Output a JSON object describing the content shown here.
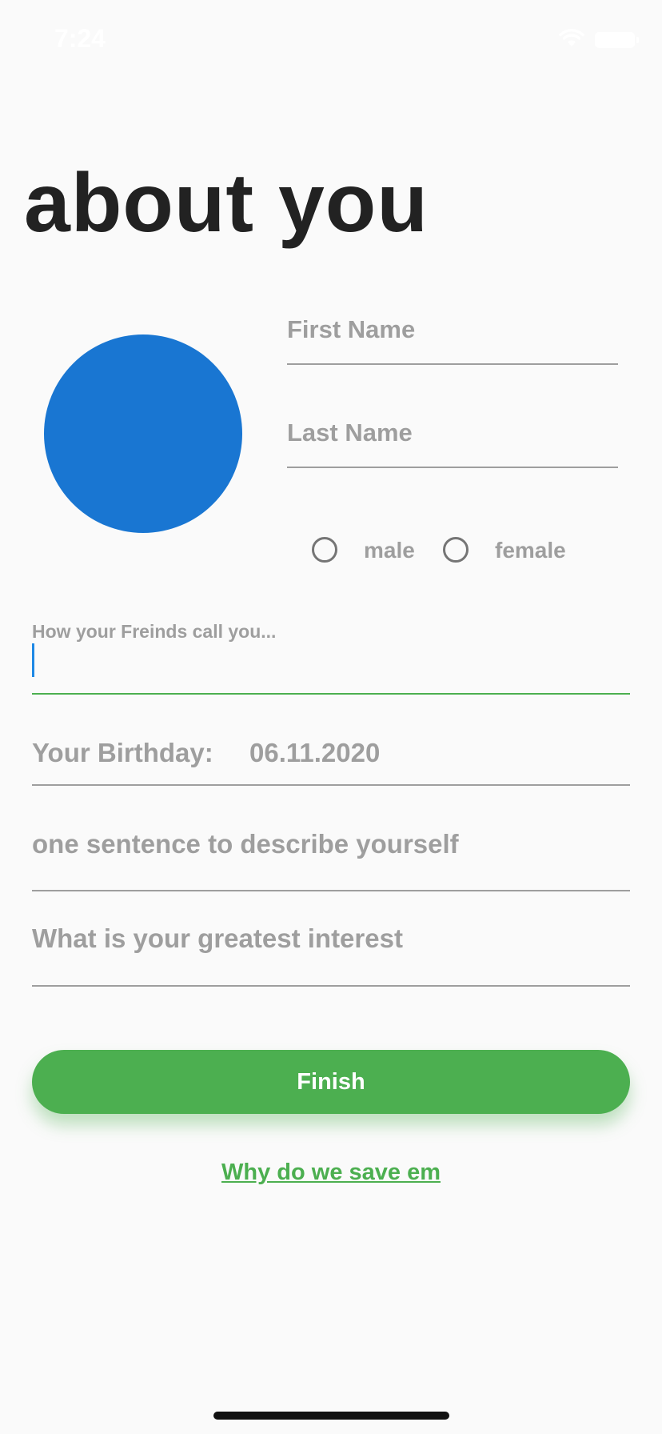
{
  "status_bar": {
    "time": "7:24",
    "wifi_icon": "wifi-icon",
    "battery_icon": "battery-icon"
  },
  "page": {
    "title": "about you"
  },
  "avatar": {
    "color": "#1976d2"
  },
  "form": {
    "first_name": {
      "placeholder": "First Name",
      "value": ""
    },
    "last_name": {
      "placeholder": "Last Name",
      "value": ""
    },
    "gender": {
      "options": [
        "male",
        "female"
      ],
      "selected": null
    },
    "nickname": {
      "label": "How your Freinds call you...",
      "value": "",
      "focused": true
    },
    "birthday": {
      "label": "Your Birthday:",
      "value": "06.11.2020"
    },
    "description": {
      "placeholder": "one sentence to describe yourself",
      "value": ""
    },
    "interest": {
      "placeholder": "What is your greatest interest",
      "value": ""
    }
  },
  "actions": {
    "finish_label": "Finish",
    "why_link": "Why do we save em"
  },
  "colors": {
    "accent": "#4caf50",
    "focus": "#1e88e5",
    "text_muted": "#9e9e9e",
    "title": "#222222"
  }
}
